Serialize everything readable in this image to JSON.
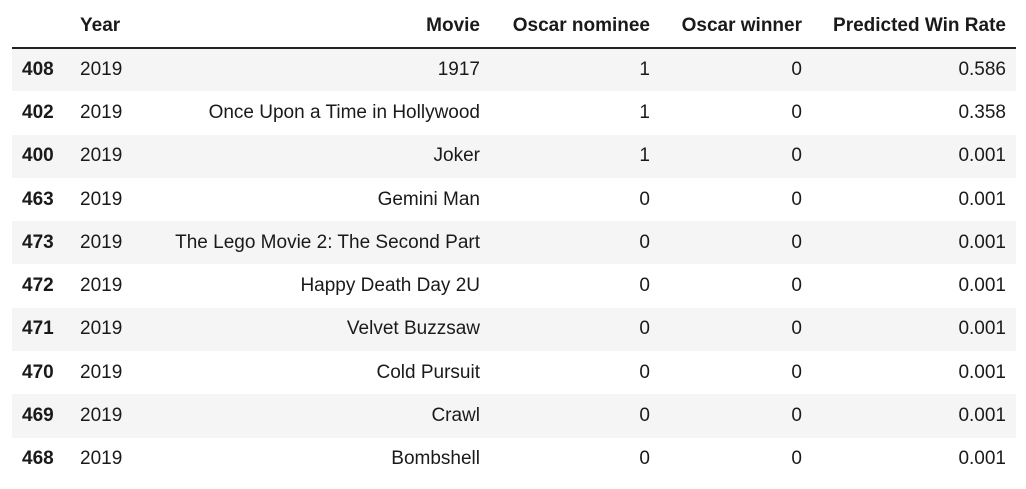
{
  "table": {
    "columns": [
      "",
      "Year",
      "Movie",
      "Oscar nominee",
      "Oscar winner",
      "Predicted Win Rate"
    ],
    "rows": [
      {
        "index": "408",
        "year": "2019",
        "movie": "1917",
        "nominee": "1",
        "winner": "0",
        "rate": "0.586"
      },
      {
        "index": "402",
        "year": "2019",
        "movie": "Once Upon a Time in Hollywood",
        "nominee": "1",
        "winner": "0",
        "rate": "0.358"
      },
      {
        "index": "400",
        "year": "2019",
        "movie": "Joker",
        "nominee": "1",
        "winner": "0",
        "rate": "0.001"
      },
      {
        "index": "463",
        "year": "2019",
        "movie": "Gemini Man",
        "nominee": "0",
        "winner": "0",
        "rate": "0.001"
      },
      {
        "index": "473",
        "year": "2019",
        "movie": "The Lego Movie 2: The Second Part",
        "nominee": "0",
        "winner": "0",
        "rate": "0.001"
      },
      {
        "index": "472",
        "year": "2019",
        "movie": "Happy Death Day 2U",
        "nominee": "0",
        "winner": "0",
        "rate": "0.001"
      },
      {
        "index": "471",
        "year": "2019",
        "movie": "Velvet Buzzsaw",
        "nominee": "0",
        "winner": "0",
        "rate": "0.001"
      },
      {
        "index": "470",
        "year": "2019",
        "movie": "Cold Pursuit",
        "nominee": "0",
        "winner": "0",
        "rate": "0.001"
      },
      {
        "index": "469",
        "year": "2019",
        "movie": "Crawl",
        "nominee": "0",
        "winner": "0",
        "rate": "0.001"
      },
      {
        "index": "468",
        "year": "2019",
        "movie": "Bombshell",
        "nominee": "0",
        "winner": "0",
        "rate": "0.001"
      }
    ]
  }
}
